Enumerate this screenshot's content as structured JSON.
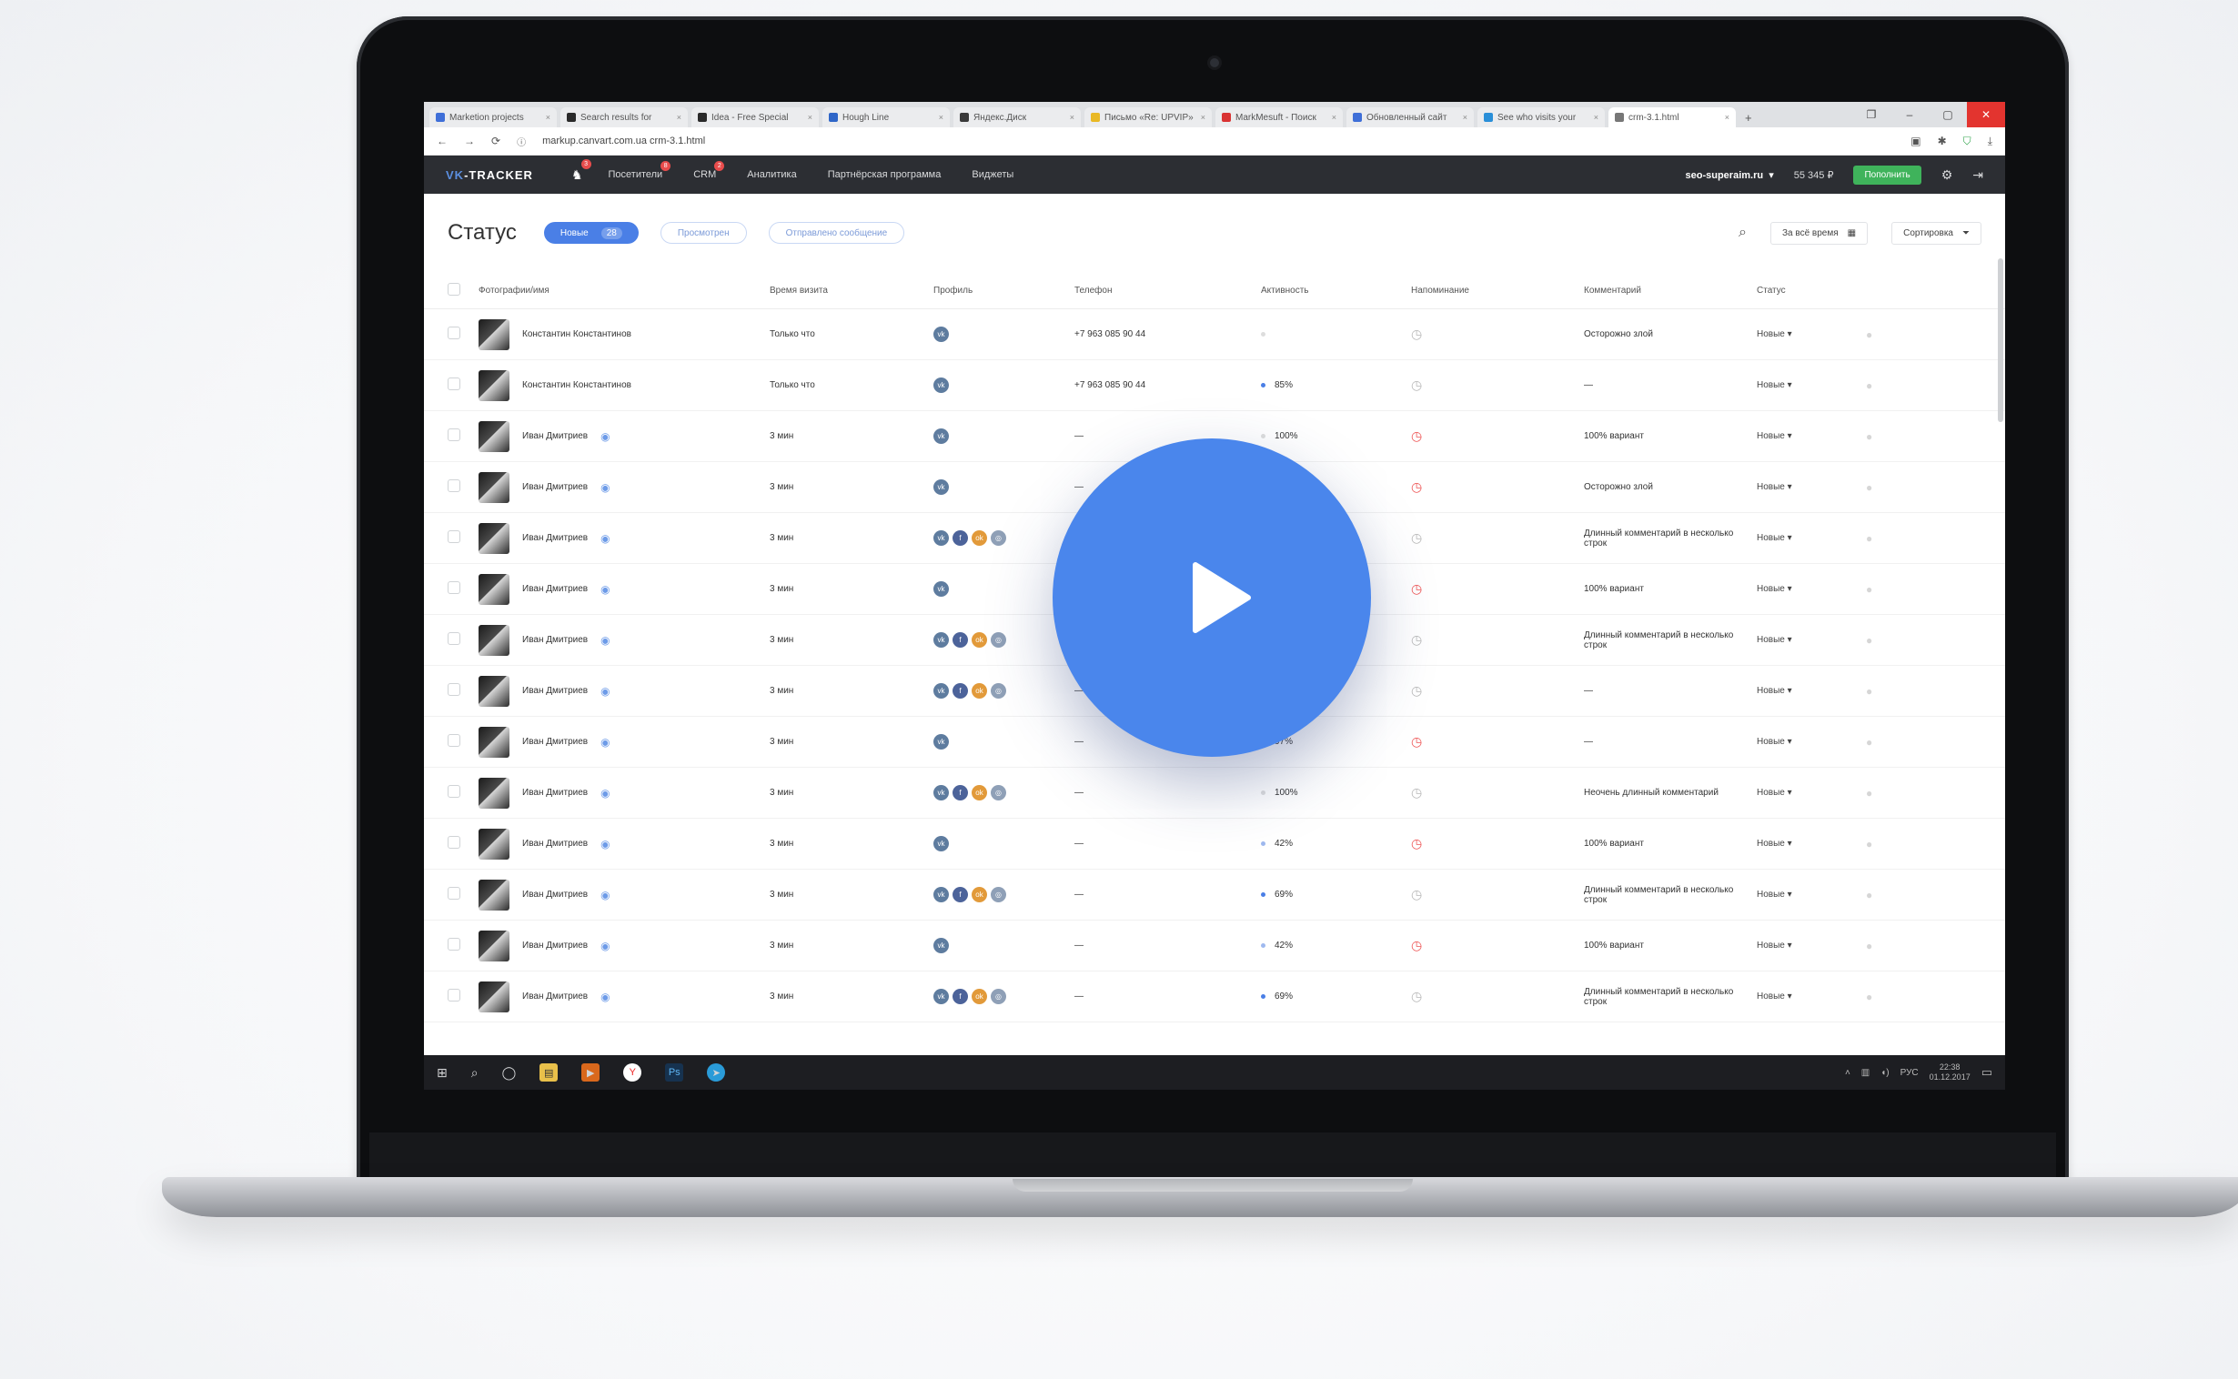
{
  "browser": {
    "tabs": [
      {
        "label": "Marketion projects",
        "color": "#3f6fd8"
      },
      {
        "label": "Search results for",
        "color": "#2a2a2a"
      },
      {
        "label": "Idea - Free Special",
        "color": "#2a2a2a"
      },
      {
        "label": "Hough Line",
        "color": "#2f66c8"
      },
      {
        "label": "Яндекс.Диск",
        "color": "#3a3a3a"
      },
      {
        "label": "Письмо «Re: UPVIP»",
        "color": "#e9b824"
      },
      {
        "label": "MarkMesuft - Поиск",
        "color": "#d93333"
      },
      {
        "label": "Обновленный сайт",
        "color": "#3f6fd8"
      },
      {
        "label": "See who visits your",
        "color": "#2a8fd8"
      },
      {
        "label": "crm-3.1.html",
        "color": "#777777",
        "active": true
      }
    ],
    "url": "markup.canvart.com.ua   crm-3.1.html"
  },
  "nav": {
    "logo_vk": "VK",
    "logo_rest": "-TRACKER",
    "bell_badge": "3",
    "items": [
      {
        "label": "Посетители",
        "badge": "8"
      },
      {
        "label": "CRM",
        "badge": "2"
      },
      {
        "label": "Аналитика"
      },
      {
        "label": "Партнёрская программа"
      },
      {
        "label": "Виджеты"
      }
    ],
    "account": "seo-superaim.ru",
    "balance": "55 345 ₽",
    "topup": "Пополнить"
  },
  "header": {
    "title": "Статус",
    "filters": [
      {
        "label": "Новые",
        "count": "28",
        "active": true
      },
      {
        "label": "Просмотрен"
      },
      {
        "label": "Отправлено сообщение"
      }
    ],
    "period": "За всё время",
    "sort": "Сортировка"
  },
  "table": {
    "columns": [
      "Фотографии/имя",
      "Время визита",
      "Профиль",
      "Телефон",
      "Активность",
      "Напоминание",
      "Комментарий",
      "Статус"
    ],
    "rows": [
      {
        "name": "Константин Константинов",
        "time": "Только что",
        "profile": [
          "vk"
        ],
        "phone": "+7 963 085 90 44",
        "activity": "",
        "dot": "#dddddd",
        "reminder": "grey",
        "comment": "Осторожно злой",
        "status": "Новые"
      },
      {
        "name": "Константин Константинов",
        "time": "Только что",
        "profile": [
          "vk"
        ],
        "phone": "+7 963 085 90 44",
        "activity": "85%",
        "dot": "#4a7fe6",
        "reminder": "grey",
        "comment": "—",
        "status": "Новые"
      },
      {
        "name": "Иван Дмитриев",
        "time": "3 мин",
        "profile": [
          "vk"
        ],
        "phone": "—",
        "activity": "100%",
        "dot": "#dddddd",
        "reminder": "red",
        "comment": "100% вариант",
        "status": "Новые"
      },
      {
        "name": "Иван Дмитриев",
        "time": "3 мин",
        "profile": [
          "vk"
        ],
        "phone": "—",
        "activity": "",
        "dot": "#ffffff",
        "reminder": "red",
        "comment": "Осторожно злой",
        "status": "Новые"
      },
      {
        "name": "Иван Дмитриев",
        "time": "3 мин",
        "profile": [
          "vk",
          "fb",
          "ok",
          "ig"
        ],
        "phone": "—",
        "activity": "",
        "dot": "#ffffff",
        "reminder": "grey",
        "comment": "Длинный комментарий в несколько строк",
        "status": "Новые"
      },
      {
        "name": "Иван Дмитриев",
        "time": "3 мин",
        "profile": [
          "vk"
        ],
        "phone": "—",
        "activity": "",
        "dot": "#ffffff",
        "reminder": "red",
        "comment": "100% вариант",
        "status": "Новые"
      },
      {
        "name": "Иван Дмитриев",
        "time": "3 мин",
        "profile": [
          "vk",
          "fb",
          "ok",
          "ig"
        ],
        "phone": "—",
        "activity": "",
        "dot": "#ffffff",
        "reminder": "grey",
        "comment": "Длинный комментарий в несколько строк",
        "status": "Новые"
      },
      {
        "name": "Иван Дмитриев",
        "time": "3 мин",
        "profile": [
          "vk",
          "fb",
          "ok",
          "ig"
        ],
        "phone": "—",
        "activity": "",
        "dot": "#ffffff",
        "reminder": "grey",
        "comment": "—",
        "status": "Новые"
      },
      {
        "name": "Иван Дмитриев",
        "time": "3 мин",
        "profile": [
          "vk"
        ],
        "phone": "—",
        "activity": "97%",
        "dot": "#4a7fe6",
        "reminder": "red",
        "comment": "—",
        "status": "Новые"
      },
      {
        "name": "Иван Дмитриев",
        "time": "3 мин",
        "profile": [
          "vk",
          "fb",
          "ok",
          "ig"
        ],
        "phone": "—",
        "activity": "100%",
        "dot": "#dddddd",
        "reminder": "grey",
        "comment": "Нeочень длинный комментарий",
        "status": "Новые"
      },
      {
        "name": "Иван Дмитриев",
        "time": "3 мин",
        "profile": [
          "vk"
        ],
        "phone": "—",
        "activity": "42%",
        "dot": "#9fb9ef",
        "reminder": "red",
        "comment": "100% вариант",
        "status": "Новые"
      },
      {
        "name": "Иван Дмитриев",
        "time": "3 мин",
        "profile": [
          "vk",
          "fb",
          "ok",
          "ig"
        ],
        "phone": "—",
        "activity": "69%",
        "dot": "#4a7fe6",
        "reminder": "grey",
        "comment": "Длинный комментарий в несколько строк",
        "status": "Новые"
      },
      {
        "name": "Иван Дмитриев",
        "time": "3 мин",
        "profile": [
          "vk"
        ],
        "phone": "—",
        "activity": "42%",
        "dot": "#9fb9ef",
        "reminder": "red",
        "comment": "100% вариант",
        "status": "Новые"
      },
      {
        "name": "Иван Дмитриев",
        "time": "3 мин",
        "profile": [
          "vk",
          "fb",
          "ok",
          "ig"
        ],
        "phone": "—",
        "activity": "69%",
        "dot": "#4a7fe6",
        "reminder": "grey",
        "comment": "Длинный комментарий в несколько строк",
        "status": "Новые"
      }
    ]
  },
  "taskbar": {
    "lang": "РУС",
    "time": "22:38",
    "date": "01.12.2017"
  }
}
